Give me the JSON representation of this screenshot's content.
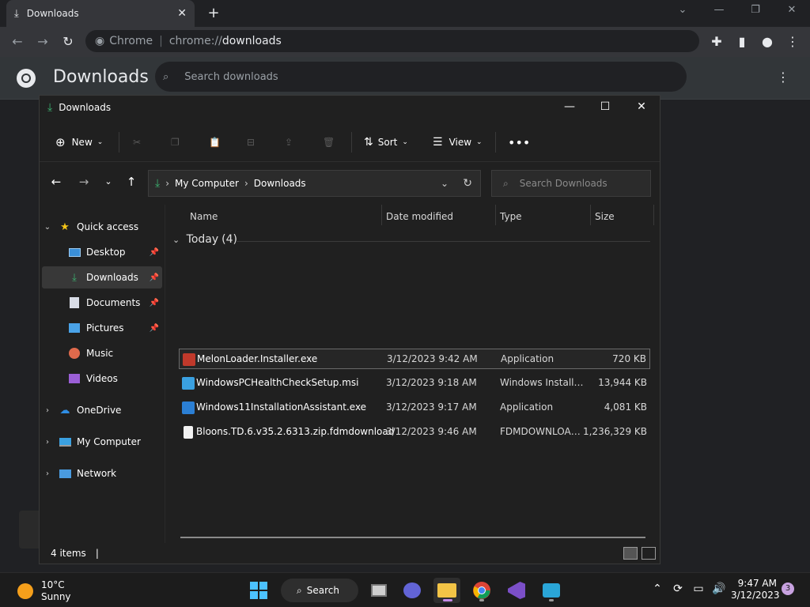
{
  "chrome": {
    "tab_title": "Downloads",
    "omnibox_site": "Chrome",
    "omnibox_scheme": "chrome://",
    "omnibox_host": "downloads"
  },
  "downloads_page": {
    "title": "Downloads",
    "search_placeholder": "Search downloads"
  },
  "explorer": {
    "title": "Downloads",
    "commandbar": {
      "new_label": "New",
      "sort_label": "Sort",
      "view_label": "View"
    },
    "address": {
      "crumbs": [
        "My Computer",
        "Downloads"
      ]
    },
    "search_placeholder": "Search Downloads",
    "nav_pane": [
      {
        "label": "Quick access",
        "icon": "star-icon"
      },
      {
        "label": "Desktop",
        "icon": "desktop-icon",
        "pinned": true
      },
      {
        "label": "Downloads",
        "icon": "download-icon",
        "pinned": true,
        "selected": true
      },
      {
        "label": "Documents",
        "icon": "documents-icon",
        "pinned": true
      },
      {
        "label": "Pictures",
        "icon": "pictures-icon",
        "pinned": true
      },
      {
        "label": "Music",
        "icon": "music-icon"
      },
      {
        "label": "Videos",
        "icon": "videos-icon"
      },
      {
        "label": "OneDrive",
        "icon": "cloud-icon"
      },
      {
        "label": "My Computer",
        "icon": "computer-icon"
      },
      {
        "label": "Network",
        "icon": "network-icon"
      }
    ],
    "columns": {
      "name": "Name",
      "date": "Date modified",
      "type": "Type",
      "size": "Size"
    },
    "group": {
      "label": "Today",
      "count": "(4)"
    },
    "files": [
      {
        "name": "MelonLoader.Installer.exe",
        "date": "3/12/2023 9:42 AM",
        "type": "Application",
        "size": "720 KB"
      },
      {
        "name": "WindowsPCHealthCheckSetup.msi",
        "date": "3/12/2023 9:18 AM",
        "type": "Windows Installer ...",
        "size": "13,944 KB"
      },
      {
        "name": "Windows11InstallationAssistant.exe",
        "date": "3/12/2023 9:17 AM",
        "type": "Application",
        "size": "4,081 KB"
      },
      {
        "name": "Bloons.TD.6.v35.2.6313.zip.fdmdownload",
        "date": "3/12/2023 9:46 AM",
        "type": "FDMDOWNLOAD ...",
        "size": "1,236,329 KB"
      }
    ],
    "status": {
      "items_count": "4 items",
      "caret": "|"
    }
  },
  "taskbar": {
    "weather_temp": "10°C",
    "weather_desc": "Sunny",
    "search_label": "Search",
    "clock_time": "9:47 AM",
    "clock_date": "3/12/2023",
    "notification_count": "3"
  },
  "colors": {
    "accent_green": "#3cb371",
    "chrome_dark": "#202124",
    "explorer_bg": "#202020"
  }
}
